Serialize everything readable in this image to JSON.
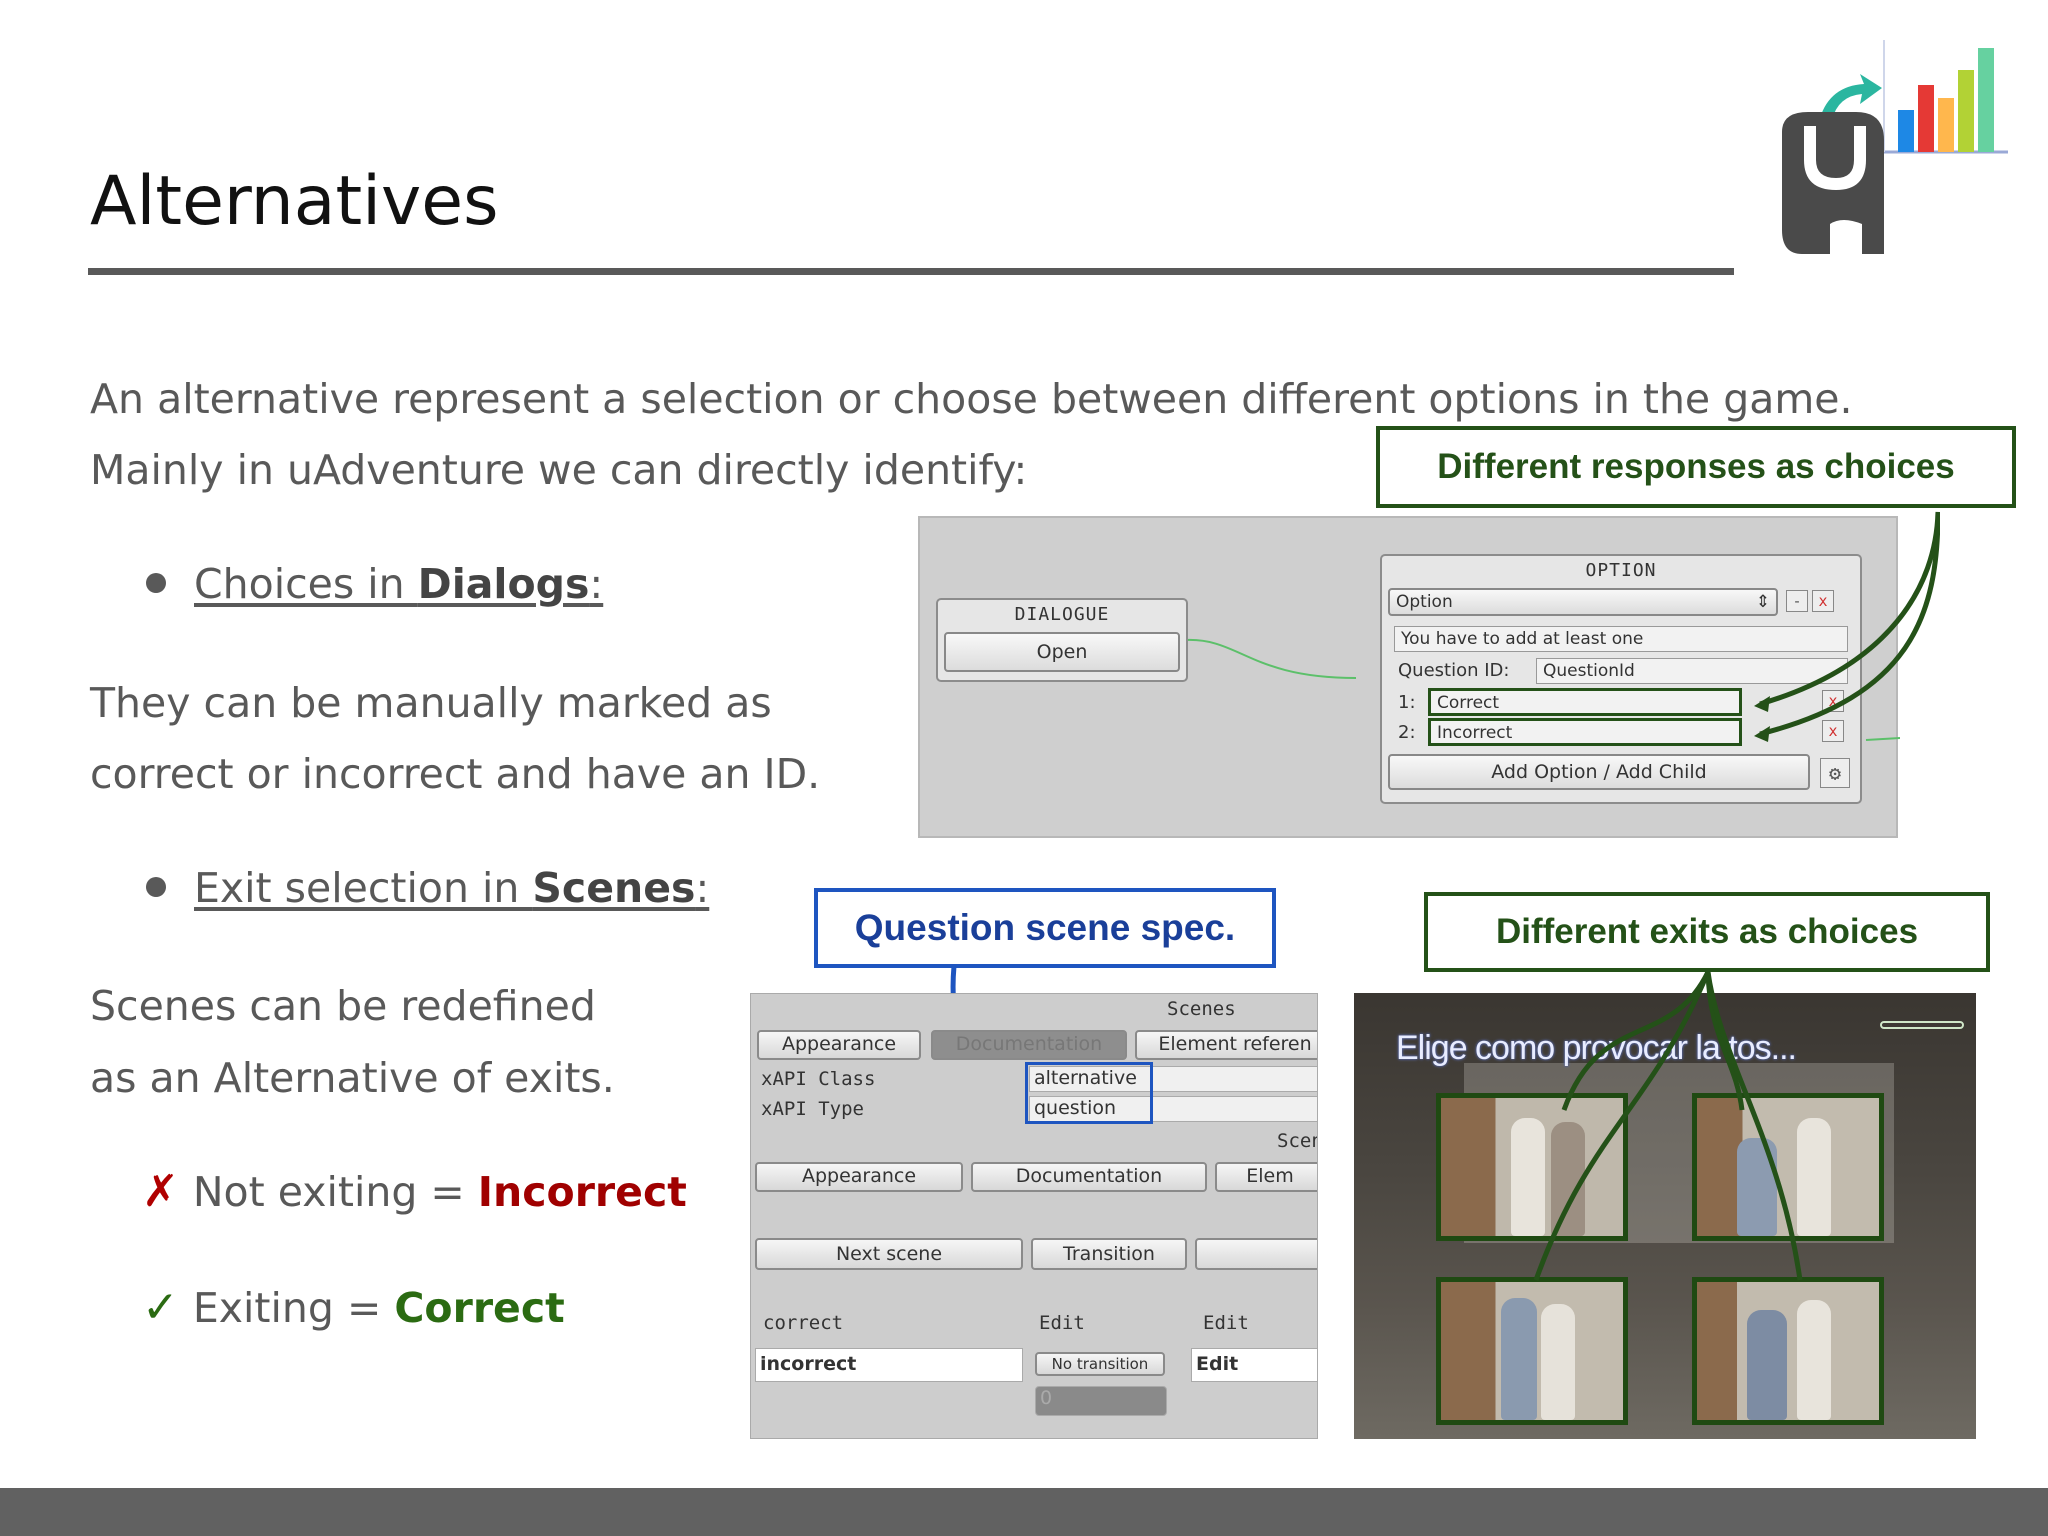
{
  "slide": {
    "title": "Alternatives",
    "intro_line1": "An alternative represent a selection or choose between different options in the game.",
    "intro_line2": "Mainly in uAdventure we can directly identify:",
    "bullet1_prefix": "Choices in ",
    "bullet1_bold": "Dialogs",
    "bullet1_suffix": ":",
    "bullet1_desc_line1": "They can be manually marked as",
    "bullet1_desc_line2": "correct or incorrect and have an ID.",
    "bullet2_prefix": "Exit selection in ",
    "bullet2_bold": "Scenes",
    "bullet2_suffix": ":",
    "bullet2_desc_line1": "Scenes can be redefined",
    "bullet2_desc_line2": "as an Alternative of exits.",
    "not_exiting_mark": "✗",
    "not_exiting_text": "Not exiting = ",
    "not_exiting_value": "Incorrect",
    "exiting_mark": "✓",
    "exiting_text": "Exiting = ",
    "exiting_value": "Correct"
  },
  "callouts": {
    "responses": "Different responses as choices",
    "question_scene": "Question scene spec.",
    "exits": "Different exits as choices"
  },
  "dialogue_editor": {
    "dialogue_node_title": "DIALOGUE",
    "dialogue_open_button": "Open",
    "option_node_title": "OPTION",
    "option_select": "Option",
    "option_select_arrow": "⇕",
    "minus": "-",
    "close": "x",
    "hint": "You have to add at least one",
    "question_id_label": "Question ID:",
    "question_id_value": "QuestionId",
    "option1_index": "1:",
    "option1_value": "Correct",
    "option2_index": "2:",
    "option2_value": "Incorrect",
    "add_option_button": "Add Option / Add Child",
    "gear": "⚙"
  },
  "scenes_panel": {
    "header": "Scenes",
    "tab_appearance": "Appearance",
    "tab_documentation": "Documentation",
    "tab_element_reference": "Element referen",
    "xapi_class_label": "xAPI Class",
    "xapi_class_value": "alternative",
    "xapi_type_label": "xAPI Type",
    "xapi_type_value": "question",
    "header2": "Scen",
    "tab2_appearance": "Appearance",
    "tab2_documentation": "Documentation",
    "tab2_element": "Elem",
    "col_next_scene": "Next scene",
    "col_transition": "Transition",
    "row1_name": "correct",
    "row1_edit1": "Edit",
    "row1_edit2": "Edit",
    "row2_name": "incorrect",
    "row2_transition": "No transition",
    "row2_edit": "Edit",
    "row2_value": "0"
  },
  "game_screen": {
    "caption": "Elige como provocar la tos..."
  },
  "colors": {
    "green_accent": "#245118",
    "blue_accent": "#1e55c0",
    "incorrect_red": "#a00000",
    "correct_green": "#2b6b12"
  },
  "icons": [
    "logo-icon",
    "bar-chart-icon",
    "arrow-icon",
    "gear-icon",
    "close-icon"
  ]
}
